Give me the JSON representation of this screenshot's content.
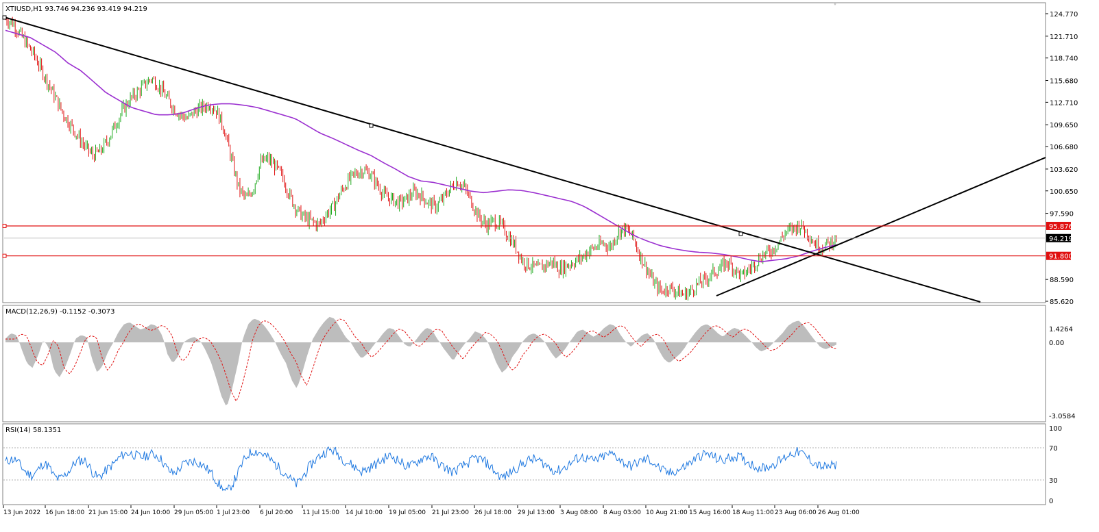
{
  "main": {
    "header": "XTIUSD,H1  93.746 94.236 93.419 94.219",
    "y_ticks": [
      "124.770",
      "121.710",
      "118.740",
      "115.680",
      "112.710",
      "109.650",
      "106.680",
      "103.620",
      "100.650",
      "97.590",
      "88.590",
      "85.620"
    ],
    "y_ticks_values": [
      124.77,
      121.71,
      118.74,
      115.68,
      112.71,
      109.65,
      106.68,
      103.62,
      100.65,
      97.59,
      88.59,
      85.62
    ],
    "y_range": [
      85.2,
      125.5
    ],
    "price_tag": "94.219",
    "level_upper": "95.876",
    "level_lower": "91.800",
    "price_value": 94.219,
    "level_upper_value": 95.876,
    "level_lower_value": 91.8
  },
  "macd": {
    "header": "MACD(12,26,9) -0.1152 -0.3073",
    "ticks": [
      "1.4264",
      "0.00",
      "-3.0584"
    ]
  },
  "rsi": {
    "header": "RSI(14) 58.1351",
    "ticks": [
      "100",
      "70",
      "30",
      "0"
    ]
  },
  "x_axis": [
    "13 Jun 2022",
    "16 Jun 18:00",
    "21 Jun 15:00",
    "24 Jun 10:00",
    "29 Jun 05:00",
    "1 Jul 23:00",
    "6 Jul 20:00",
    "11 Jul 15:00",
    "14 Jul 10:00",
    "19 Jul 05:00",
    "21 Jul 23:00",
    "26 Jul 18:00",
    "29 Jul 13:00",
    "3 Aug 08:00",
    "8 Aug 03:00",
    "10 Aug 21:00",
    "15 Aug 16:00",
    "18 Aug 11:00",
    "23 Aug 06:00",
    "26 Aug 01:00"
  ],
  "colors": {
    "bull": "#1faa1f",
    "bear": "#e01010",
    "ma": "#9b30d0",
    "level": "#e01010",
    "trend": "#000000",
    "histogram": "#bdbdbd",
    "signal": "#e01010",
    "rsi": "#1e78e0"
  },
  "chart_data": {
    "type": "line",
    "series": [
      {
        "values": [
          124.0,
          123.5,
          122.0,
          120.5,
          119.0,
          117.0,
          115.0,
          113.0,
          111.0,
          109.5,
          108.0,
          106.5,
          105.5,
          106.0,
          107.5,
          109.5,
          111.5,
          113.0,
          114.0,
          115.0,
          116.0,
          115.0,
          113.5,
          112.0,
          111.0,
          110.5,
          111.5,
          112.0,
          112.5,
          111.5,
          109.0,
          105.0,
          101.0,
          99.5,
          101.0,
          104.5,
          105.0,
          104.0,
          102.5,
          100.0,
          98.0,
          97.0,
          96.5,
          96.0,
          97.5,
          98.5,
          100.5,
          102.0,
          103.0,
          103.5,
          103.0,
          101.5,
          100.0,
          99.5,
          99.0,
          99.5,
          100.5,
          100.0,
          99.0,
          98.5,
          99.5,
          101.0,
          102.0,
          101.0,
          99.0,
          97.0,
          96.0,
          96.5,
          96.0,
          94.5,
          93.0,
          91.0,
          90.5,
          90.0,
          90.5,
          91.0,
          90.0,
          90.5,
          91.0,
          91.5,
          92.5,
          93.0,
          93.5,
          93.0,
          95.0,
          95.5,
          94.5,
          92.0,
          90.0,
          88.0,
          87.0,
          87.5,
          87.0,
          86.5,
          87.0,
          88.0,
          88.5,
          89.5,
          90.0,
          91.0,
          90.0,
          89.0,
          90.0,
          91.0,
          92.0,
          92.5,
          93.5,
          95.0,
          95.5,
          96.0,
          95.0,
          93.5,
          93.0,
          93.5,
          94.2
        ]
      },
      {
        "values": [
          122.5,
          122.0,
          121.5,
          120.5,
          119.5,
          118.0,
          117.0,
          115.5,
          114.0,
          113.0,
          112.0,
          111.5,
          111.0,
          111.0,
          111.2,
          111.8,
          112.3,
          112.5,
          112.5,
          112.3,
          112.0,
          111.5,
          111.0,
          110.5,
          109.5,
          108.5,
          107.8,
          107.0,
          106.2,
          105.5,
          104.5,
          103.6,
          102.6,
          102.0,
          101.8,
          101.4,
          101.0,
          100.6,
          100.4,
          100.6,
          100.8,
          100.7,
          100.4,
          100.0,
          99.6,
          99.2,
          98.5,
          97.5,
          96.5,
          95.5,
          94.5,
          93.8,
          93.2,
          92.8,
          92.5,
          92.3,
          92.2,
          92.0,
          91.7,
          91.3,
          91.0,
          91.2,
          91.4,
          91.8,
          92.4,
          92.9,
          93.3
        ]
      }
    ],
    "macd_hist": [
      0.2,
      0.5,
      0.4,
      -0.3,
      -0.9,
      -1.1,
      -0.6,
      0.1,
      -0.2,
      -1.2,
      -1.5,
      -1.1,
      -0.5,
      0.2,
      0.4,
      0.3,
      -0.7,
      -1.3,
      -1.0,
      -0.4,
      0.0,
      0.6,
      1.0,
      1.1,
      0.9,
      0.7,
      0.8,
      1.0,
      0.9,
      0.4,
      -0.5,
      -0.9,
      -0.6,
      0.0,
      0.2,
      0.3,
      0.1,
      -0.3,
      -0.8,
      -1.5,
      -2.3,
      -2.8,
      -2.0,
      -1.0,
      0.2,
      1.0,
      1.3,
      1.2,
      0.9,
      0.5,
      0.0,
      -0.5,
      -0.9,
      -1.6,
      -2.0,
      -1.3,
      -0.5,
      0.2,
      0.7,
      1.1,
      1.4,
      1.3,
      0.8,
      0.3,
      0.0,
      -0.4,
      -0.7,
      -0.5,
      -0.2,
      0.1,
      0.5,
      0.8,
      0.7,
      0.3,
      -0.1,
      -0.2,
      0.1,
      0.5,
      0.8,
      0.7,
      0.2,
      -0.2,
      -0.5,
      -0.8,
      -0.4,
      -0.1,
      0.2,
      0.6,
      0.5,
      0.2,
      -0.3,
      -0.9,
      -1.3,
      -1.1,
      -0.6,
      -0.3,
      0.1,
      0.4,
      0.5,
      0.3,
      0.0,
      -0.4,
      -0.7,
      -0.5,
      -0.2,
      0.2,
      0.6,
      0.7,
      0.5,
      0.3,
      0.5,
      0.8,
      1.0,
      0.9,
      0.4,
      0.0,
      -0.2,
      0.1,
      0.4,
      0.5,
      0.2,
      -0.3,
      -0.7,
      -0.9,
      -0.7,
      -0.5,
      -0.2,
      0.2,
      0.6,
      0.9,
      1.0,
      0.8,
      0.5,
      0.3,
      0.6,
      0.8,
      0.7,
      0.4,
      0.1,
      -0.2,
      -0.4,
      -0.3,
      -0.1,
      0.2,
      0.5,
      0.9,
      1.1,
      1.2,
      0.9,
      0.5,
      0.1,
      -0.2,
      -0.3,
      -0.2,
      -0.1
    ]
  }
}
